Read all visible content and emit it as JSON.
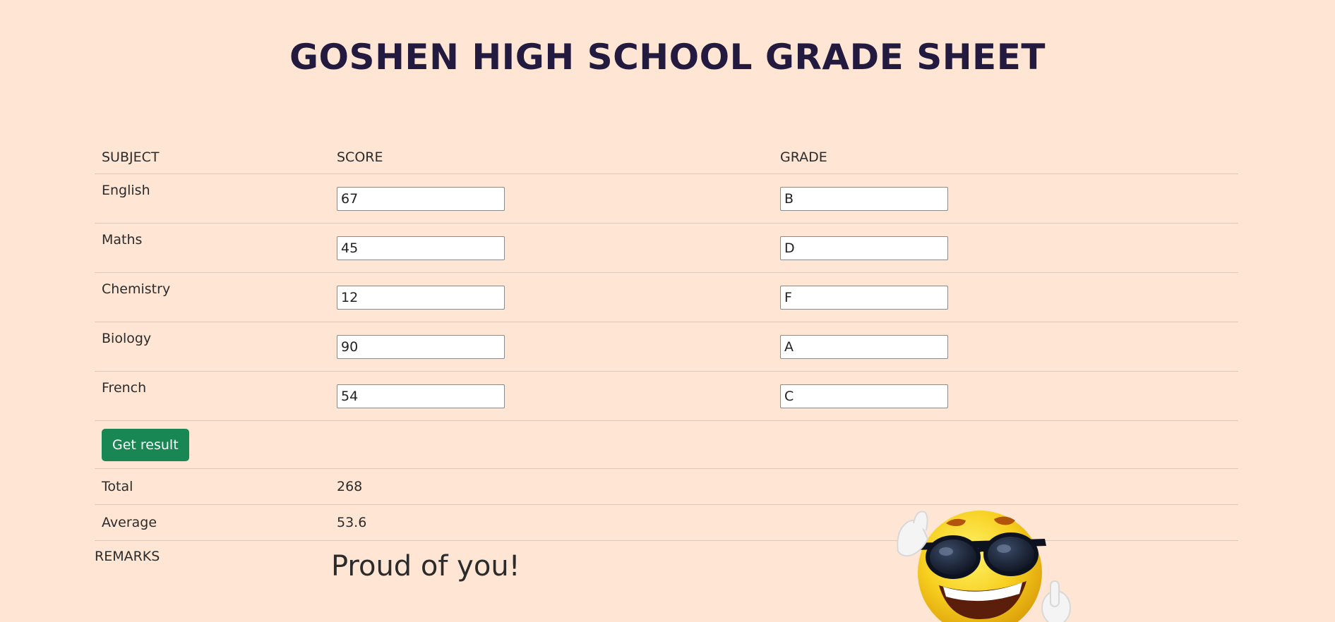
{
  "page": {
    "title": "GOSHEN HIGH SCHOOL GRADE SHEET"
  },
  "table": {
    "headers": {
      "subject": "SUBJECT",
      "score": "SCORE",
      "grade": "GRADE"
    },
    "rows": [
      {
        "subject": "English",
        "score": "67",
        "grade": "B"
      },
      {
        "subject": "Maths",
        "score": "45",
        "grade": "D"
      },
      {
        "subject": "Chemistry",
        "score": "12",
        "grade": "F"
      },
      {
        "subject": "Biology",
        "score": "90",
        "grade": "A"
      },
      {
        "subject": "French",
        "score": "54",
        "grade": "C"
      }
    ],
    "button_label": "Get result",
    "total_label": "Total",
    "total_value": "268",
    "average_label": "Average",
    "average_value": "53.6"
  },
  "remarks": {
    "label": "REMARKS",
    "text": "Proud of you!",
    "image": "cool-emoji-sunglasses-icon"
  },
  "colors": {
    "background": "#ffe6d4",
    "title": "#231a3f",
    "button": "#198754"
  }
}
